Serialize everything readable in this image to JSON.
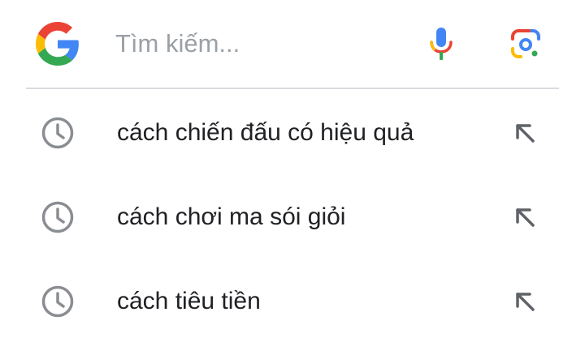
{
  "search": {
    "placeholder": "Tìm kiếm...",
    "value": "",
    "logo_icon": "google-g-logo",
    "mic_icon": "mic-icon",
    "lens_icon": "google-lens-icon"
  },
  "colors": {
    "blue": "#4285F4",
    "red": "#EA4335",
    "yellow": "#FBBC05",
    "green": "#34A853",
    "icon_gray": "#8a8d91",
    "divider": "#dadce0",
    "text": "#202124"
  },
  "suggestions": [
    {
      "text": "cách chiến đấu có hiệu quả",
      "icon": "history-icon",
      "action_icon": "fill-query-arrow-icon"
    },
    {
      "text": "cách chơi ma sói giỏi",
      "icon": "history-icon",
      "action_icon": "fill-query-arrow-icon"
    },
    {
      "text": "cách tiêu tiền",
      "icon": "history-icon",
      "action_icon": "fill-query-arrow-icon"
    }
  ]
}
